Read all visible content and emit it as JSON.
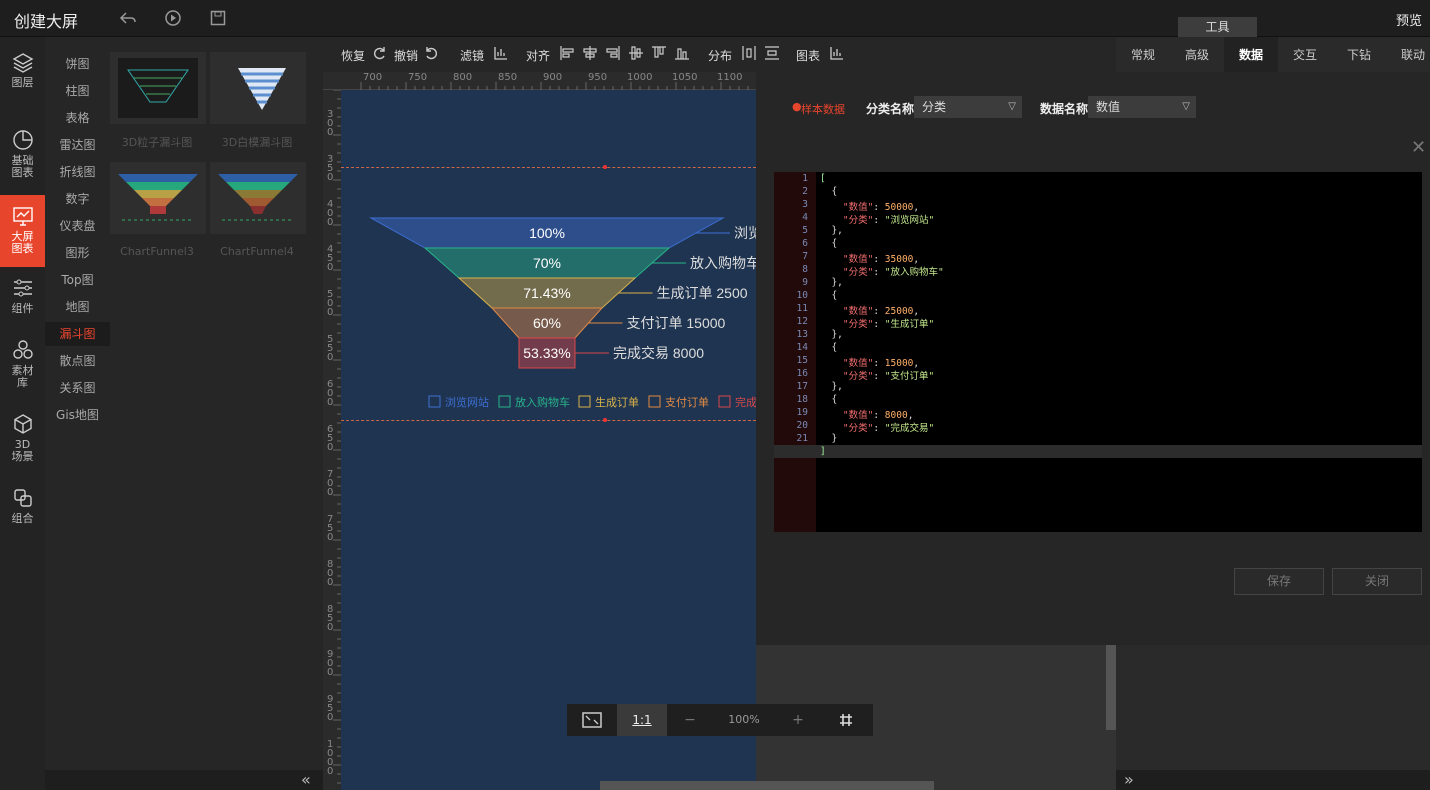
{
  "app": {
    "title": "创建大屏",
    "preview": "预览",
    "tools_tab": "工具"
  },
  "left_nav": [
    {
      "label": "图层",
      "icon": "layers-icon"
    },
    {
      "label": "基础图表",
      "icon": "pie-chart-icon"
    },
    {
      "label": "大屏图表",
      "icon": "monitor-chart-icon",
      "active": true
    },
    {
      "label": "组件",
      "icon": "sliders-icon"
    },
    {
      "label": "素材库",
      "icon": "cubes-icon"
    },
    {
      "label": "3D场景",
      "icon": "cube-3d-icon"
    },
    {
      "label": "组合",
      "icon": "group-icon"
    }
  ],
  "categories": [
    "饼图",
    "柱图",
    "表格",
    "雷达图",
    "折线图",
    "数字",
    "仪表盘",
    "图形",
    "Top图",
    "地图",
    "漏斗图",
    "散点图",
    "关系图",
    "Gis地图"
  ],
  "active_category": "漏斗图",
  "thumbnails": [
    "3D粒子漏斗图",
    "3D白模漏斗图",
    "ChartFunnel3",
    "ChartFunnel4"
  ],
  "toolbar": {
    "redo": "恢复",
    "undo": "撤销",
    "filter": "滤镜",
    "align": "对齐",
    "distribute": "分布",
    "chart": "图表"
  },
  "ruler_h": [
    "700",
    "750",
    "800",
    "850",
    "900",
    "950",
    "1000",
    "1050",
    "1100"
  ],
  "ruler_v": [
    "300",
    "350",
    "400",
    "450",
    "500",
    "550",
    "600",
    "650",
    "700",
    "750",
    "800",
    "850",
    "900",
    "950",
    "1000"
  ],
  "funnel": {
    "percents": [
      "100%",
      "70%",
      "71.43%",
      "60%",
      "53.33%"
    ],
    "labels": [
      "浏览网站",
      "放入购物车",
      "生成订单 2500",
      "支付订单 15000",
      "完成交易 8000"
    ],
    "legend": [
      "浏览网站",
      "放入购物车",
      "生成订单",
      "支付订单",
      "完成"
    ],
    "colors": [
      "#3d6fd3",
      "#27b48a",
      "#d8b24a",
      "#e08a45",
      "#d84848"
    ]
  },
  "zoom": {
    "ratio": "1:1",
    "minus": "−",
    "value": "100%",
    "plus": "+"
  },
  "right_tabs": [
    "常规",
    "高级",
    "数据",
    "交互",
    "下钻",
    "联动"
  ],
  "active_right_tab": "数据",
  "data_dialog": {
    "sample": "样本数据",
    "cat_label": "分类名称",
    "cat_value": "分类",
    "val_label": "数据名称",
    "val_value": "数值",
    "save": "保存",
    "close": "关闭"
  },
  "chart_data": {
    "type": "table",
    "rows": [
      {
        "数值": 50000,
        "分类": "浏览网站"
      },
      {
        "数值": 35000,
        "分类": "放入购物车"
      },
      {
        "数值": 25000,
        "分类": "生成订单"
      },
      {
        "数值": 15000,
        "分类": "支付订单"
      },
      {
        "数值": 8000,
        "分类": "完成交易"
      }
    ]
  }
}
